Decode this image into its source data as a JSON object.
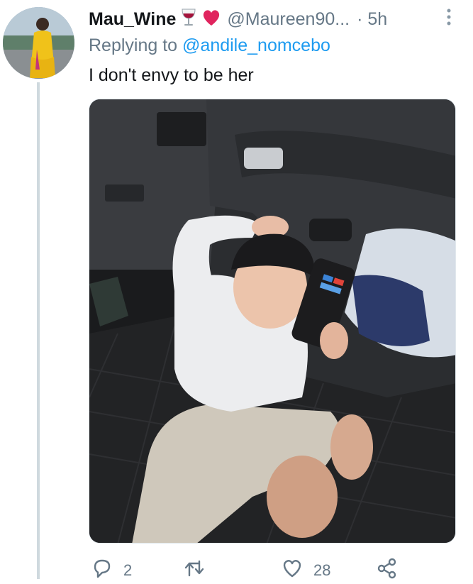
{
  "tweet": {
    "display_name": "Mau_Wine",
    "handle": "@Maureen90...",
    "time": "· 5h",
    "reply_prefix": "Replying to ",
    "reply_to": "@andile_nomcebo",
    "text": "I don't envy to be her"
  },
  "icons": {
    "name_emojis": [
      "wine-glass-icon",
      "heart-icon"
    ],
    "more": "more-vertical-icon",
    "reply": "reply-icon",
    "retweet": "retweet-icon",
    "like": "heart-outline-icon",
    "share": "share-icon"
  },
  "actions": {
    "reply_count": "2",
    "retweet_count": "",
    "like_count": "28"
  },
  "colors": {
    "accent": "#1d9bf0",
    "secondary_text": "#657786",
    "heart": "#e0245e"
  }
}
